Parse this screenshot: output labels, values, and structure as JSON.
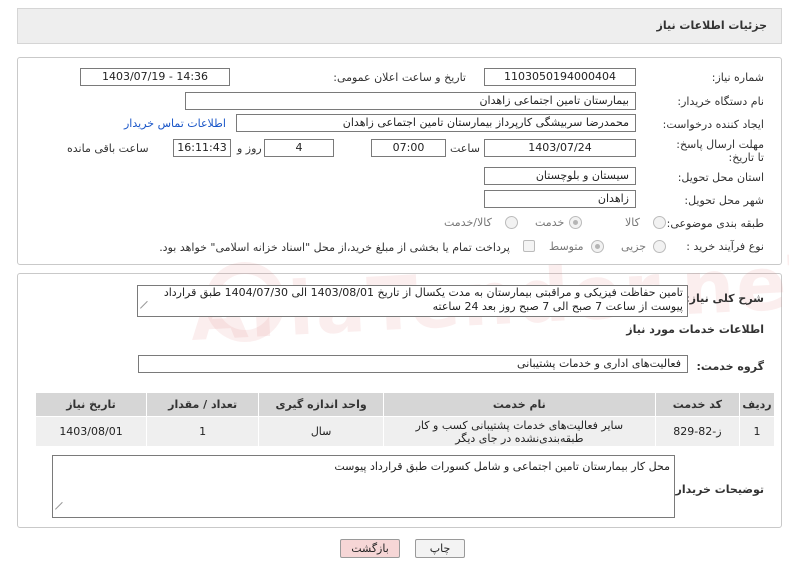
{
  "header": {
    "title": "جزئیات اطلاعات نیاز"
  },
  "form": {
    "need_number": {
      "label": "شماره نیاز:",
      "value": "1103050194000404"
    },
    "announce_datetime": {
      "label": "تاریخ و ساعت اعلان عمومی:",
      "value": "1403/07/19 - 14:36"
    },
    "buyer_org": {
      "label": "نام دستگاه خریدار:",
      "value": "بیمارستان تامین اجتماعی زاهدان"
    },
    "requester": {
      "label": "ایجاد کننده درخواست:",
      "value": "محمدرضا سربیشگی کارپرداز بیمارستان تامین اجتماعی زاهدان",
      "contact_link": "اطلاعات تماس خریدار"
    },
    "deadline": {
      "label": "مهلت ارسال پاسخ: تا تاریخ:",
      "date": "1403/07/24",
      "time_label": "ساعت",
      "time": "07:00",
      "days": "4",
      "days_label": "روز و",
      "remaining": "16:11:43",
      "remaining_label": "ساعت باقی مانده"
    },
    "province": {
      "label": "استان محل تحویل:",
      "value": "سیستان و بلوچستان"
    },
    "city": {
      "label": "شهر محل تحویل:",
      "value": "زاهدان"
    },
    "category": {
      "label": "طبقه بندی موضوعی:",
      "options": [
        "کالا",
        "خدمت",
        "کالا/خدمت"
      ],
      "selected": "خدمت"
    },
    "purchase_type": {
      "label": "نوع فرآیند خرید :",
      "options": [
        "جزیی",
        "متوسط"
      ],
      "selected": "متوسط",
      "note": "پرداخت تمام یا بخشی از مبلغ خرید،از محل \"اسناد خزانه اسلامی\" خواهد بود."
    }
  },
  "summary": {
    "label": "شرح کلی نیاز:",
    "text": "تامین حفاظت فیزیکی و مراقبتی بیمارستان به مدت یکسال از تاریخ 1403/08/01 الی 1404/07/30 طبق قرارداد پیوست  از ساعت 7 صبح  الی 7 صبح روز بعد 24 ساعته"
  },
  "services": {
    "section_title": "اطلاعات خدمات مورد نیاز",
    "group_label": "گروه خدمت:",
    "group_value": "فعالیت‌های اداری و خدمات پشتیبانی",
    "columns": [
      "ردیف",
      "کد خدمت",
      "نام خدمت",
      "واحد اندازه گیری",
      "تعداد / مقدار",
      "تاریخ نیاز"
    ],
    "rows": [
      {
        "row": "1",
        "code": "ز-82-829",
        "name": "سایر فعالیت‌های خدمات پشتیبانی کسب و کار طبقه‌بندی‌نشده در جای دیگر",
        "unit": "سال",
        "qty": "1",
        "date": "1403/08/01"
      }
    ]
  },
  "buyer_notes": {
    "label": "توضیحات خریدار:",
    "text": "محل کار بیمارستان تامین اجتماعی و شامل کسورات طبق قرارداد پیوست"
  },
  "buttons": {
    "print": "چاپ",
    "back": "بازگشت"
  },
  "watermark": "AriaTender.neT",
  "colors": {
    "link": "#1a56c8",
    "back_button": "#f6d6d6",
    "print_button": "#f3f3f3",
    "table_header": "#d6d6d6"
  }
}
